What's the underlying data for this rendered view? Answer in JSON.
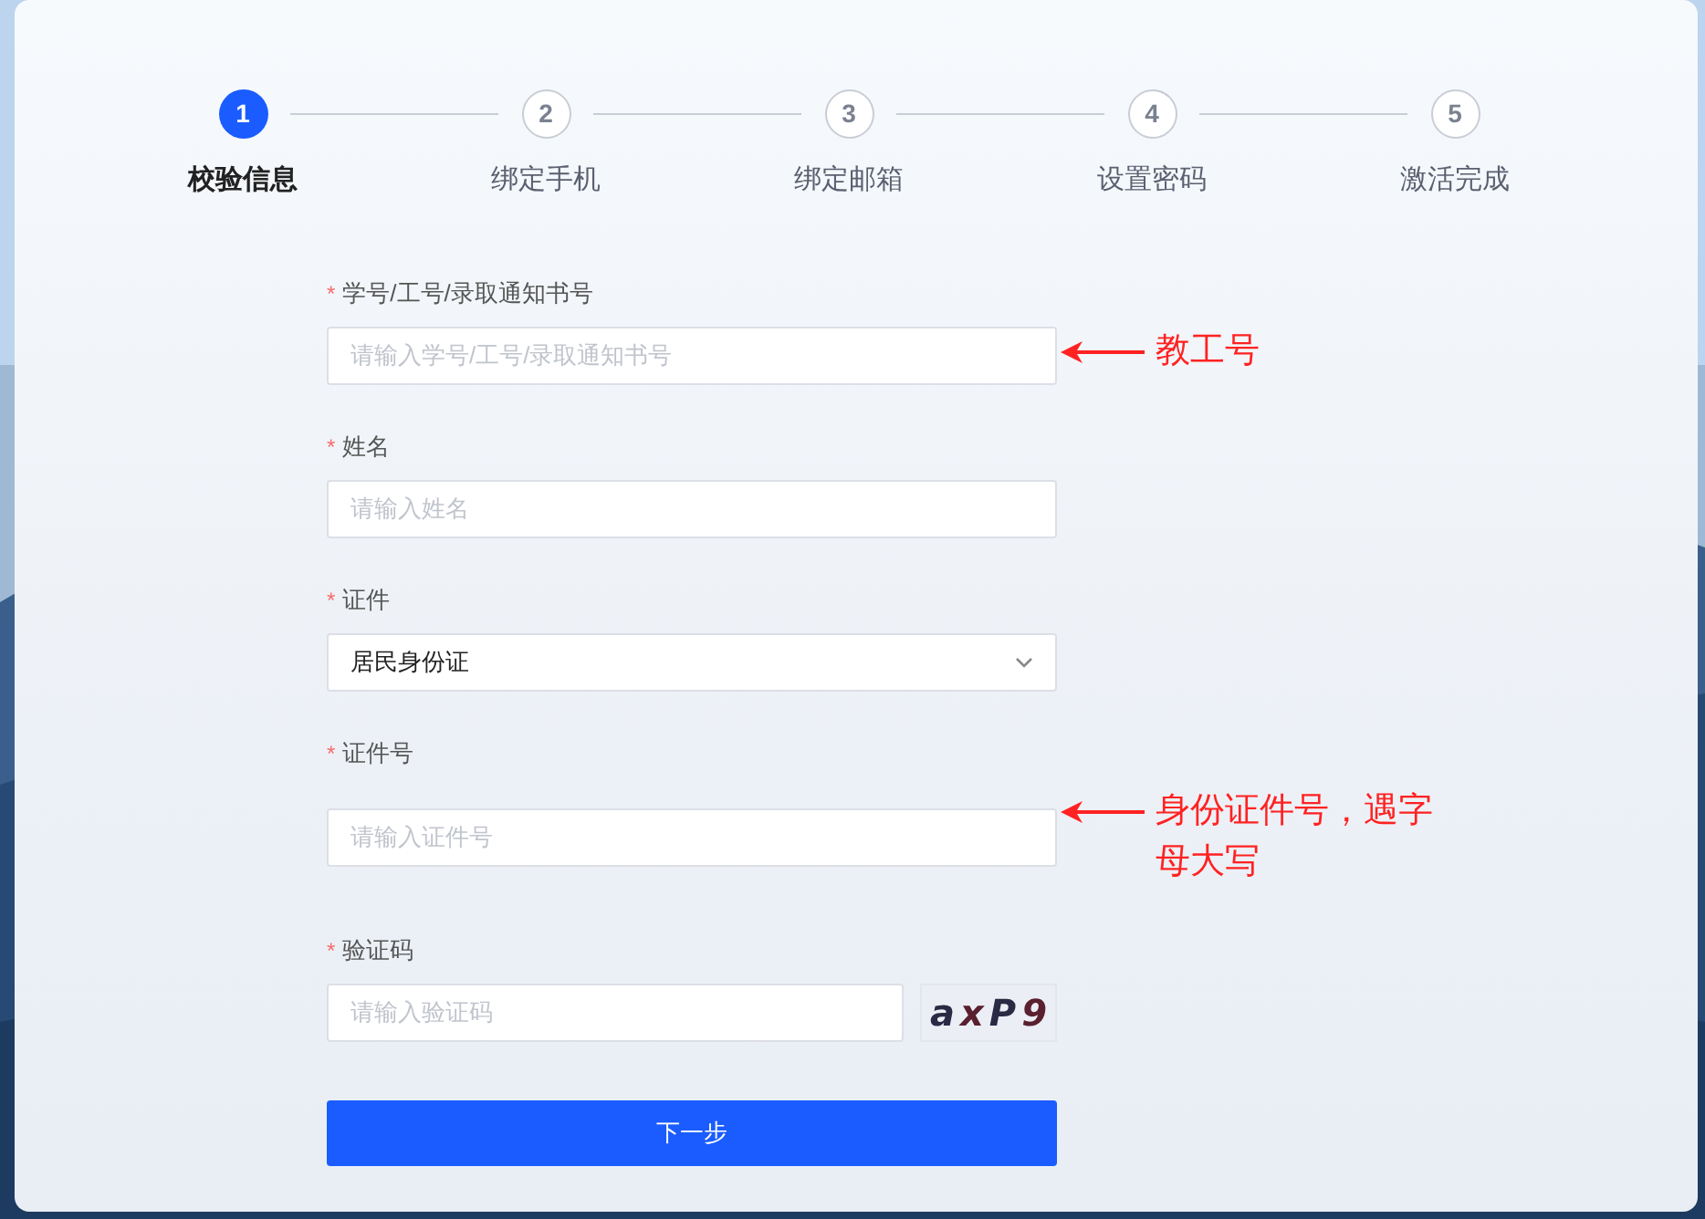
{
  "steps": [
    {
      "number": "1",
      "label": "校验信息",
      "selected": true
    },
    {
      "number": "2",
      "label": "绑定手机",
      "selected": false
    },
    {
      "number": "3",
      "label": "绑定邮箱",
      "selected": false
    },
    {
      "number": "4",
      "label": "设置密码",
      "selected": false
    },
    {
      "number": "5",
      "label": "激活完成",
      "selected": false
    }
  ],
  "fields": [
    {
      "kind": "input",
      "mark": "*",
      "label": "学号/工号/录取通知书号",
      "placeholder": "请输入学号/工号/录取通知书号",
      "note": "教工号"
    },
    {
      "kind": "input",
      "mark": "*",
      "label": "姓名",
      "placeholder": "请输入姓名"
    },
    {
      "kind": "select",
      "mark": "*",
      "label": "证件",
      "value": "居民身份证"
    },
    {
      "kind": "input",
      "mark": "*",
      "label": "证件号",
      "placeholder": "请输入证件号",
      "note": "身份证件号，遇字母大写"
    },
    {
      "kind": "captcha",
      "mark": "*",
      "label": "验证码",
      "placeholder": "请输入验证码",
      "captcha": [
        "a",
        "x",
        "P",
        "9"
      ]
    }
  ],
  "submit": "下一步"
}
